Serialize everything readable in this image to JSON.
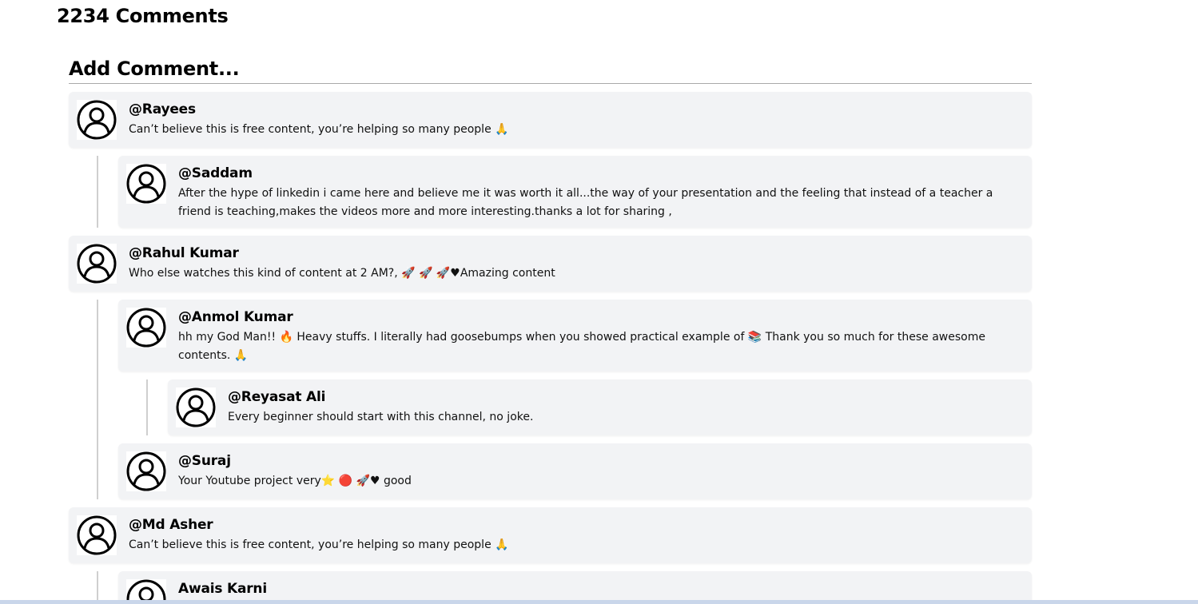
{
  "header": {
    "comments_count": "2234 Comments",
    "add_comment_label": "Add Comment..."
  },
  "comments": [
    {
      "username": "@Rayees",
      "text": "Can’t believe this is free content, you’re helping so many people 🙏"
    },
    {
      "username": "@Saddam",
      "text": "After the hype of linkedin i came here and believe me it was worth it all...the way of your presentation and the feeling that instead of a teacher a friend is teaching,makes the videos more and more interesting.thanks a lot for sharing ,"
    },
    {
      "username": "@Rahul Kumar",
      "text": "Who else watches this kind of content at 2 AM?, 🚀 🚀 🚀♥Amazing content"
    },
    {
      "username": "@Anmol Kumar",
      "text": "hh my God Man!! 🔥 Heavy stuffs. I literally had goosebumps when you showed practical example of 📚 Thank you so much for these awesome contents. 🙏"
    },
    {
      "username": "@Reyasat Ali",
      "text": "Every beginner should start with this channel, no joke."
    },
    {
      "username": "@Suraj",
      "text": "Your Youtube project very⭐ 🔴 🚀♥ good"
    },
    {
      "username": "@Md Asher",
      "text": "Can’t believe this is free content, you’re helping so many people 🙏"
    },
    {
      "username": "Awais Karni",
      "text": ""
    }
  ],
  "icons": {
    "avatar": "user-avatar-icon"
  },
  "colors": {
    "card_background": "#f2f3f5",
    "thread_line": "#cfcfcf",
    "divider": "#a9a9a9"
  }
}
